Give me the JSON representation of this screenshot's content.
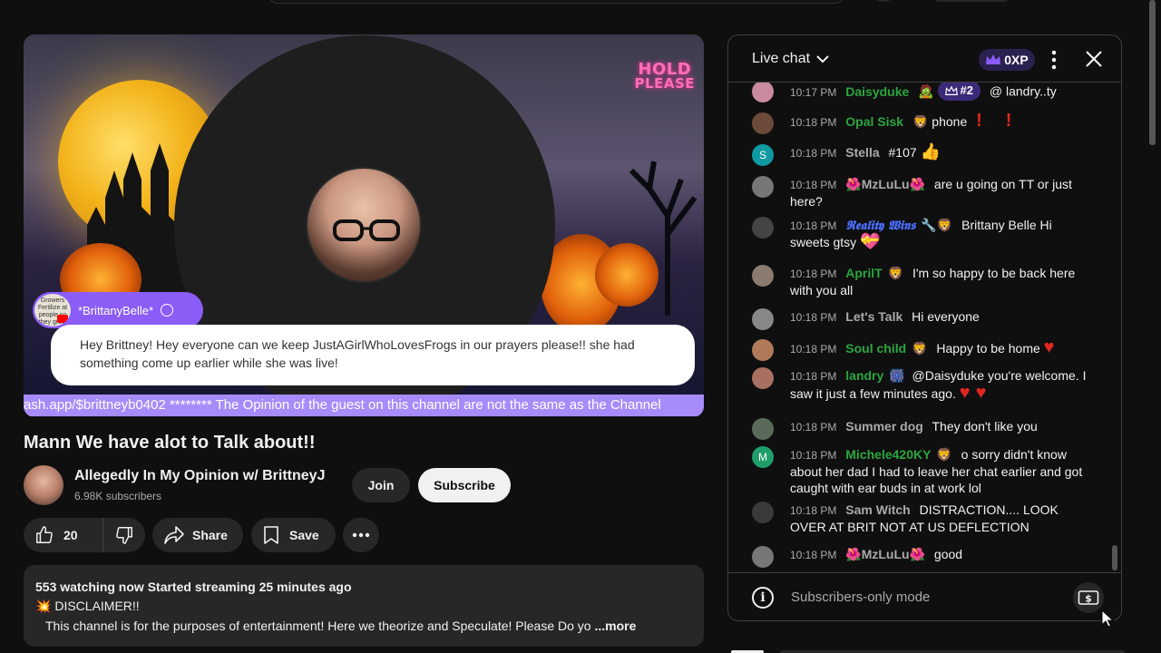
{
  "player": {
    "hold_line1": "HOLD",
    "hold_line2": "PLEASE",
    "overlay_author": "*BrittanyBelle*",
    "overlay_avatar_text": "Growers Fertilize at people so they grow ulch",
    "overlay_message": "Hey Brittney! Hey everyone can we keep JustAGirlWhoLovesFrogs in our prayers please!! she had something come up earlier while she was live!",
    "ticker": "ash.app/$brittneyb0402 ******** The Opinion of the guest on this channel are not the same as the Channel"
  },
  "video": {
    "title": "Mann We have alot to Talk about!!",
    "channel_name": "Allegedly In My Opinion w/ BrittneyJ",
    "subscribers": "6.98K subscribers",
    "join_label": "Join",
    "subscribe_label": "Subscribe",
    "like_count": "20",
    "share_label": "Share",
    "save_label": "Save"
  },
  "description": {
    "meta": "553 watching now  Started streaming 25 minutes ago",
    "line2_icon": "💥",
    "line2": "DISCLAIMER!!",
    "line3": "This channel is for the purposes of entertainment!  Here we theorize and Speculate!  Please Do yo",
    "more": "...more"
  },
  "chat": {
    "title": "Live chat",
    "xp": "0XP",
    "footer_text": "Subscribers-only mode",
    "messages": [
      {
        "time": "10:17 PM",
        "author": "Daisyduke",
        "emoji": "🧟",
        "rank": "#2",
        "text": "@ landry..ty"
      },
      {
        "time": "10:18 PM",
        "author": "Opal Sisk",
        "emoji": "🦁",
        "text": "phone"
      },
      {
        "time": "10:18 PM",
        "author": "Stella",
        "avatar_letter": "S",
        "text": "#107"
      },
      {
        "time": "10:18 PM",
        "author": "MzLuLu",
        "emoji": "🌺",
        "text": "are u going on TT or just here?"
      },
      {
        "time": "10:18 PM",
        "author": "𝕽𝖊𝖆𝖑𝖎𝖙𝖞 𝖂𝖎𝖓𝖘",
        "emoji": "🔧🦁",
        "text": "Brittany Belle Hi sweets gtsy"
      },
      {
        "time": "10:18 PM",
        "author": "AprilT",
        "emoji": "🦁",
        "text": "I'm so happy to be back here with you all"
      },
      {
        "time": "10:18 PM",
        "author": "Let's Talk",
        "text": "Hi everyone"
      },
      {
        "time": "10:18 PM",
        "author": "Soul child",
        "emoji": "🦁",
        "text": "Happy to be home"
      },
      {
        "time": "10:18 PM",
        "author": "landry",
        "emoji": "🎆",
        "text": "@Daisyduke you're welcome. I saw it just a few minutes ago."
      },
      {
        "time": "10:18 PM",
        "author": "Summer dog",
        "text": "They don't like you"
      },
      {
        "time": "10:18 PM",
        "author": "Michele420KY",
        "avatar_letter": "M",
        "emoji": "🦁",
        "text": "o sorry didn't know about her dad I had to leave her chat earlier and got caught with ear buds in at work lol"
      },
      {
        "time": "10:18 PM",
        "author": "Sam Witch",
        "text": "DISTRACTION.... LOOK OVER AT BRIT NOT AT US DEFLECTION"
      },
      {
        "time": "10:18 PM",
        "author": "MzLuLu",
        "emoji": "🌺",
        "text": "good"
      }
    ]
  },
  "colors": {
    "accent_purple": "#8b5cf6",
    "ticker_purple": "#a78bfa",
    "member_green": "#2ba640",
    "heart_red": "#e0261f"
  },
  "icons": [
    "chevron-down-icon",
    "crown-icon",
    "kebab-icon",
    "close-icon",
    "like-icon",
    "dislike-icon",
    "share-icon",
    "save-icon",
    "more-icon",
    "info-icon",
    "money-icon",
    "verified-icon"
  ]
}
